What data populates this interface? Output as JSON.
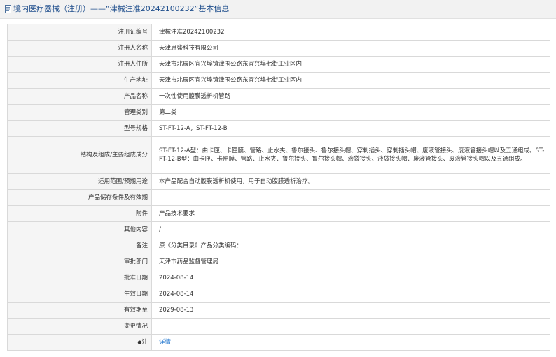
{
  "header": {
    "title": "境内医疗器械（注册）——“津械注准20242100232”基本信息",
    "icon": "document-icon"
  },
  "rows": [
    {
      "label": "注册证编号",
      "value": "津械注准20242100232"
    },
    {
      "label": "注册人名称",
      "value": "天津思盛科技有限公司"
    },
    {
      "label": "注册人住所",
      "value": "天津市北辰区宜兴埠镇津围公路东宜兴埠七街工业区内"
    },
    {
      "label": "生产地址",
      "value": "天津市北辰区宜兴埠镇津围公路东宜兴埠七街工业区内"
    },
    {
      "label": "产品名称",
      "value": "一次性使用腹膜透析机管路"
    },
    {
      "label": "管理类别",
      "value": "第二类"
    },
    {
      "label": "型号规格",
      "value": "ST-FT-12-A，ST-FT-12-B"
    },
    {
      "label": "结构及组成/主要组成成分",
      "value": "ST-FT-12-A型：由卡匣、卡匣膜、管路、止水夹、鲁尔接头、鲁尔接头帽、穿刺插头、穿刺插头帽、废液管接头、废液管接头帽以及五通组成。ST-FT-12-B型：由卡匣、卡匣膜、管路、止水夹、鲁尔接头、鲁尔接头帽、液袋接头、液袋接头帽、废液管接头、废液管接头帽以及五通组成。"
    },
    {
      "label": "适用范围/预期用途",
      "value": "本产品配合自动腹膜透析机使用，用于自动腹膜透析治疗。"
    },
    {
      "label": "产品储存条件及有效期",
      "value": ""
    },
    {
      "label": "附件",
      "value": "产品技术要求"
    },
    {
      "label": "其他内容",
      "value": "/"
    },
    {
      "label": "备注",
      "value": "原《分类目录》产品分类编码："
    },
    {
      "label": "审批部门",
      "value": "天津市药品监督管理局"
    },
    {
      "label": "批准日期",
      "value": "2024-08-14"
    },
    {
      "label": "生效日期",
      "value": "2024-08-14"
    },
    {
      "label": "有效期至",
      "value": "2029-08-13"
    },
    {
      "label": "变更情况",
      "value": ""
    }
  ],
  "note_row": {
    "star": "●",
    "label": "注",
    "link": "详情"
  },
  "colors": {
    "title": "#1f4e8c",
    "link": "#2a7bd0",
    "label_bg": "#f5f5f5",
    "border": "#d9d9d9"
  }
}
